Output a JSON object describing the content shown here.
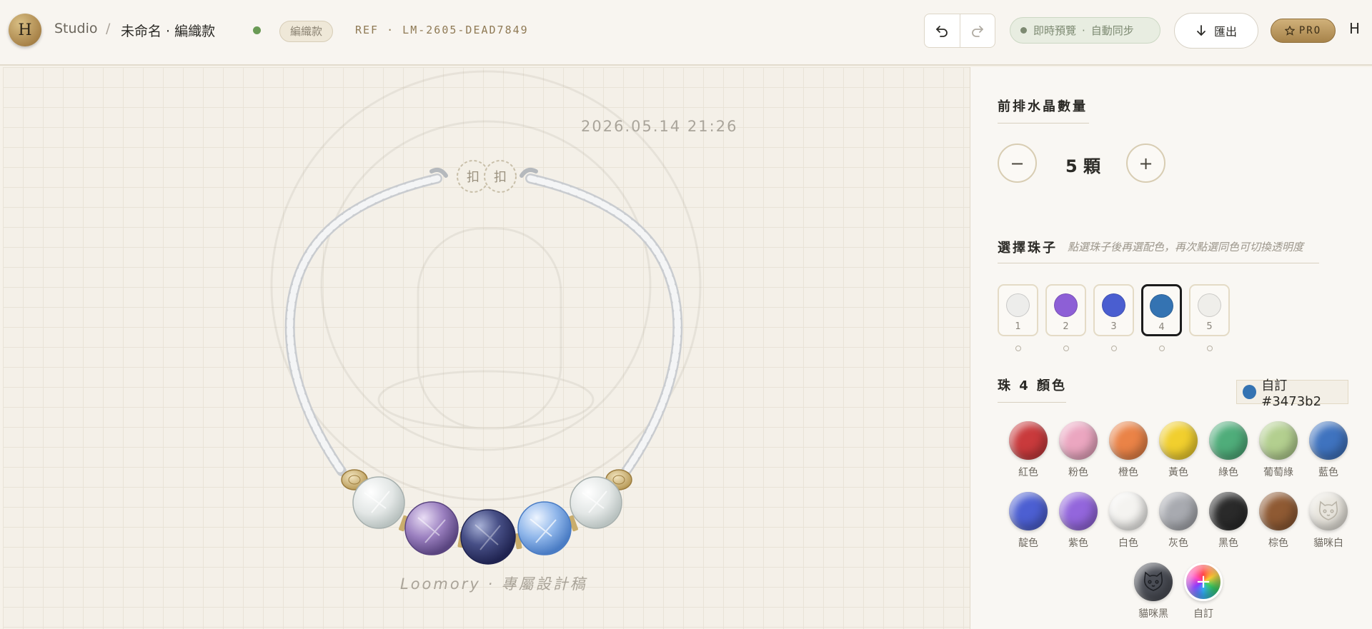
{
  "header": {
    "avatar_letter": "H",
    "breadcrumb_studio": "Studio",
    "breadcrumb_sep": "/",
    "breadcrumb_title": "未命名 · 編織款",
    "tag": "編織款",
    "ref": "REF · LM-2605-DEAD7849",
    "preview_label": "即時預覽",
    "preview_sep": "·",
    "sync_label": "自動同步",
    "export_label": "匯出",
    "pro_label": "PRO",
    "user_letter": "H"
  },
  "canvas": {
    "timestamp": "2026.05.14 21:26",
    "clasp_left": "扣",
    "clasp_right": "扣",
    "caption": "Loomory · 專屬設計稿"
  },
  "panel": {
    "count_title": "前排水晶數量",
    "count_value": "5 顆",
    "minus": "−",
    "plus": "+",
    "select_title": "選擇珠子",
    "select_hint": "點選珠子後再選配色，再次點選同色可切換透明度",
    "slots": [
      {
        "num": "1",
        "color": "#ededeb"
      },
      {
        "num": "2",
        "color": "#8d5fd6"
      },
      {
        "num": "3",
        "color": "#4a5ed0"
      },
      {
        "num": "4",
        "color": "#3473b2"
      },
      {
        "num": "5",
        "color": "#efeeea"
      }
    ],
    "active_slot": "4",
    "color_title": "珠 4 顏色",
    "custom_chip": "自訂 #3473b2",
    "swatches": [
      {
        "label": "紅色",
        "color": "#c93a3c"
      },
      {
        "label": "粉色",
        "color": "#eba6c0"
      },
      {
        "label": "橙色",
        "color": "#ea8347"
      },
      {
        "label": "黃色",
        "color": "#f1cf2e"
      },
      {
        "label": "綠色",
        "color": "#4fad7a"
      },
      {
        "label": "葡萄綠",
        "color": "#b3cf8f"
      },
      {
        "label": "藍色",
        "color": "#3f73bf"
      },
      {
        "label": "靛色",
        "color": "#4c5fd2"
      },
      {
        "label": "紫色",
        "color": "#9366dc"
      },
      {
        "label": "白色",
        "color": "#f4f3f0"
      },
      {
        "label": "灰色",
        "color": "#a8aab0"
      },
      {
        "label": "黑色",
        "color": "#2a2a2a"
      },
      {
        "label": "棕色",
        "color": "#8f5a33"
      },
      {
        "label": "貓咪白",
        "color": "#e8e5dd"
      },
      {
        "label": "貓咪黑",
        "color": "#4a4d55"
      },
      {
        "label": "自訂",
        "color": "conic"
      }
    ]
  }
}
